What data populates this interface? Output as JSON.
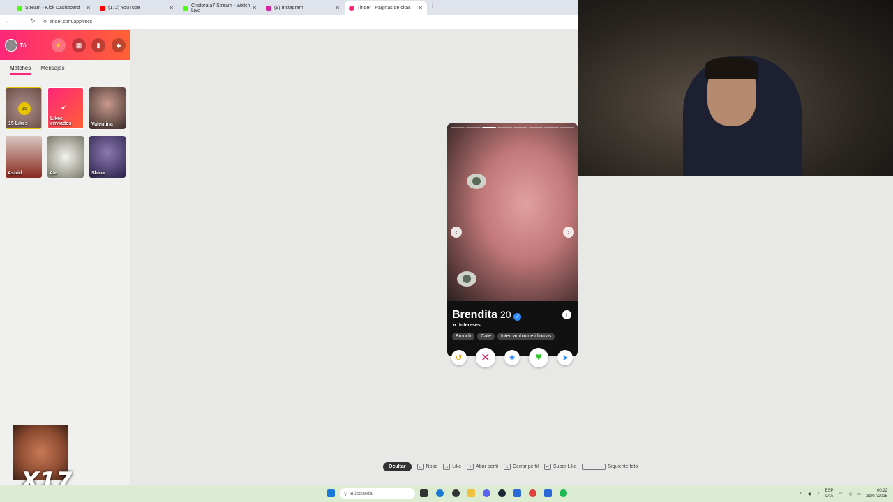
{
  "browser": {
    "tabs": [
      {
        "label": "Stream - Kick Dashboard",
        "favicon_color": "#53fc18"
      },
      {
        "label": "(172) YouTube",
        "favicon_color": "#ff0000"
      },
      {
        "label": "Cristorata7 Stream - Watch Live",
        "favicon_color": "#53fc18"
      },
      {
        "label": "(9) Instagram",
        "favicon_color": "#d6249f"
      },
      {
        "label": "Tinder | Páginas de citas",
        "favicon_color": "#fd267a"
      }
    ],
    "new_tab": "+",
    "url": "tinder.com/app/recs"
  },
  "sidebar": {
    "user": "Tú",
    "tabs": [
      "Matches",
      "Mensajes"
    ],
    "cards": [
      {
        "label": "15 Likes",
        "badge": "15"
      },
      {
        "label": "Likes enviados"
      },
      {
        "label": "Valentina"
      },
      {
        "label": "Astrid"
      },
      {
        "label": "Ale"
      },
      {
        "label": "Shina"
      }
    ]
  },
  "profile": {
    "name": "Brendita",
    "age": "20",
    "interests_label": "Intereses",
    "interests": [
      "Brunch",
      "Café",
      "Intercambio de idiomas"
    ],
    "photo_count": 8,
    "current_photo": 3
  },
  "actions": {
    "rewind": "↺",
    "nope": "✕",
    "super_like": "★",
    "like": "♥",
    "boost": "➤"
  },
  "shortcuts": {
    "hide": "Ocultar",
    "items": [
      "Nope",
      "Like",
      "Abrir perfil",
      "Cerrar perfil",
      "Super Like",
      "Siguiente foto"
    ]
  },
  "meme": {
    "text": "X17"
  },
  "taskbar": {
    "search_placeholder": "Búsqueda",
    "lang": "ESP",
    "lang2": "LAA",
    "time": "00:22",
    "date": "31/07/2025"
  },
  "colors": {
    "brand": "#fd267a",
    "brand2": "#ff6036"
  }
}
